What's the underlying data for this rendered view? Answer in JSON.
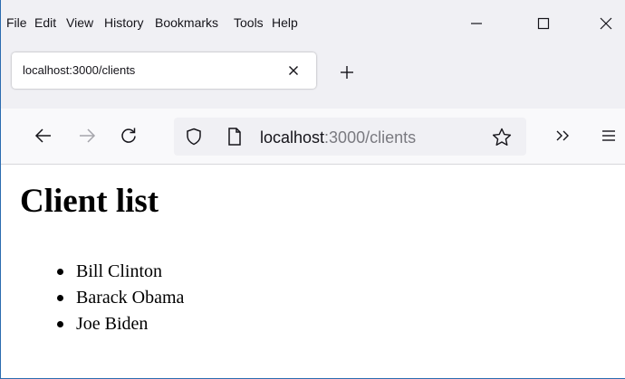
{
  "menu": {
    "file": "File",
    "edit": "Edit",
    "view": "View",
    "history": "History",
    "bookmarks": "Bookmarks",
    "tools": "Tools",
    "help": "Help"
  },
  "window_controls": [
    "minimize-icon",
    "maximize-icon",
    "close-icon"
  ],
  "tab": {
    "title": "localhost:3000/clients",
    "close_icon": "close-icon"
  },
  "new_tab_icon": "plus-icon",
  "nav": {
    "back_icon": "arrow-left-icon",
    "forward_icon": "arrow-right-icon",
    "reload_icon": "reload-icon"
  },
  "urlbar": {
    "host": "localhost",
    "rest": ":3000/clients",
    "shield_icon": "shield-icon",
    "page_icon": "page-icon",
    "bookmark_icon": "star-icon"
  },
  "toolbar": {
    "overflow_icon": "double-chevron-right-icon",
    "menu_icon": "hamburger-menu-icon"
  },
  "page": {
    "title": "Client list",
    "clients": [
      "Bill Clinton",
      "Barack Obama",
      "Joe Biden"
    ]
  },
  "colors": {
    "chrome_bg": "#f0f0f4",
    "toolbar_bg": "#f9f9fb",
    "window_border": "#2b6cb0",
    "url_dim_text": "#7a7a80"
  }
}
